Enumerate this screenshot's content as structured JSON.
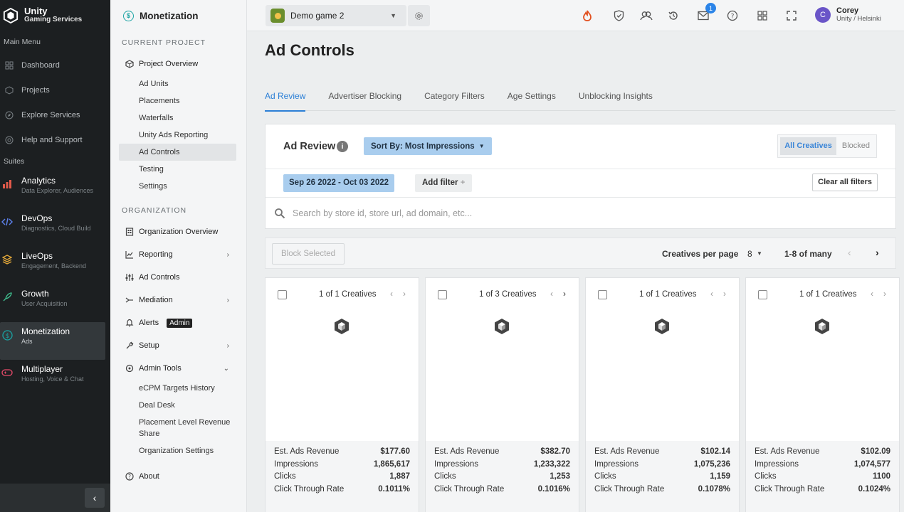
{
  "brand": {
    "title": "Unity",
    "subtitle": "Gaming Services"
  },
  "rail": {
    "main_menu_label": "Main Menu",
    "main_items": [
      {
        "label": "Dashboard",
        "icon": "dashboard-icon"
      },
      {
        "label": "Projects",
        "icon": "cube-icon"
      },
      {
        "label": "Explore Services",
        "icon": "compass-icon"
      },
      {
        "label": "Help and Support",
        "icon": "help-icon"
      }
    ],
    "suites_label": "Suites",
    "suites": [
      {
        "title": "Analytics",
        "subtitle": "Data Explorer, Audiences",
        "color": "#e25a4a"
      },
      {
        "title": "DevOps",
        "subtitle": "Diagnostics, Cloud Build",
        "color": "#5b7fe8"
      },
      {
        "title": "LiveOps",
        "subtitle": "Engagement, Backend",
        "color": "#e3a83a"
      },
      {
        "title": "Growth",
        "subtitle": "User Acquisition",
        "color": "#3fbf8f"
      },
      {
        "title": "Monetization",
        "subtitle": "Ads",
        "color": "#1aa3a3",
        "active": true
      },
      {
        "title": "Multiplayer",
        "subtitle": "Hosting, Voice & Chat",
        "color": "#e84a6a"
      }
    ]
  },
  "subnav": {
    "title": "Monetization",
    "current_project_label": "CURRENT PROJECT",
    "project_overview": "Project Overview",
    "project_items": [
      "Ad Units",
      "Placements",
      "Waterfalls",
      "Unity Ads Reporting",
      "Ad Controls",
      "Testing",
      "Settings"
    ],
    "active_item": "Ad Controls",
    "organization_label": "ORGANIZATION",
    "org_items": {
      "overview": "Organization Overview",
      "reporting": "Reporting",
      "ad_controls": "Ad Controls",
      "mediation": "Mediation",
      "alerts": "Alerts",
      "alerts_badge": "Admin",
      "setup": "Setup",
      "admin_tools": "Admin Tools"
    },
    "admin_tools_items": [
      "eCPM Targets History",
      "Deal Desk",
      "Placement Level Revenue Share",
      "Organization Settings"
    ],
    "about": "About"
  },
  "topbar": {
    "project_name": "Demo game 2",
    "notification_count": "1",
    "user_name": "Corey",
    "user_org": "Unity / Helsinki",
    "avatar_letter": "C"
  },
  "page": {
    "title": "Ad Controls",
    "tabs": [
      "Ad Review",
      "Advertiser Blocking",
      "Category Filters",
      "Age Settings",
      "Unblocking Insights"
    ],
    "active_tab": "Ad Review"
  },
  "review_panel": {
    "title": "Ad Review",
    "sort_label": "Sort By: Most Impressions",
    "segment": [
      "All Creatives",
      "Blocked"
    ],
    "date_range": "Sep 26 2022 - Oct 03 2022",
    "add_filter": "Add filter",
    "clear_filters": "Clear all filters",
    "search_placeholder": "Search by store id, store url, ad domain, etc..."
  },
  "pager": {
    "block_selected": "Block Selected",
    "per_page_label": "Creatives per page",
    "per_page_value": "8",
    "range_text": "1-8 of many"
  },
  "stat_labels": [
    "Est. Ads Revenue",
    "Impressions",
    "Clicks",
    "Click Through Rate"
  ],
  "cards": [
    {
      "count": "1 of 1 Creatives",
      "revenue": "$177.60",
      "impressions": "1,865,617",
      "clicks": "1,887",
      "ctr": "0.1011%"
    },
    {
      "count": "1 of 3 Creatives",
      "revenue": "$382.70",
      "impressions": "1,233,322",
      "clicks": "1,253",
      "ctr": "0.1016%"
    },
    {
      "count": "1 of 1 Creatives",
      "revenue": "$102.14",
      "impressions": "1,075,236",
      "clicks": "1,159",
      "ctr": "0.1078%"
    },
    {
      "count": "1 of 1 Creatives",
      "revenue": "$102.09",
      "impressions": "1,074,577",
      "clicks": "1100",
      "ctr": "0.1024%"
    }
  ],
  "colors": {
    "accent": "#2b7fd6",
    "chip": "#a9cdee",
    "rail": "#1c1f21"
  }
}
